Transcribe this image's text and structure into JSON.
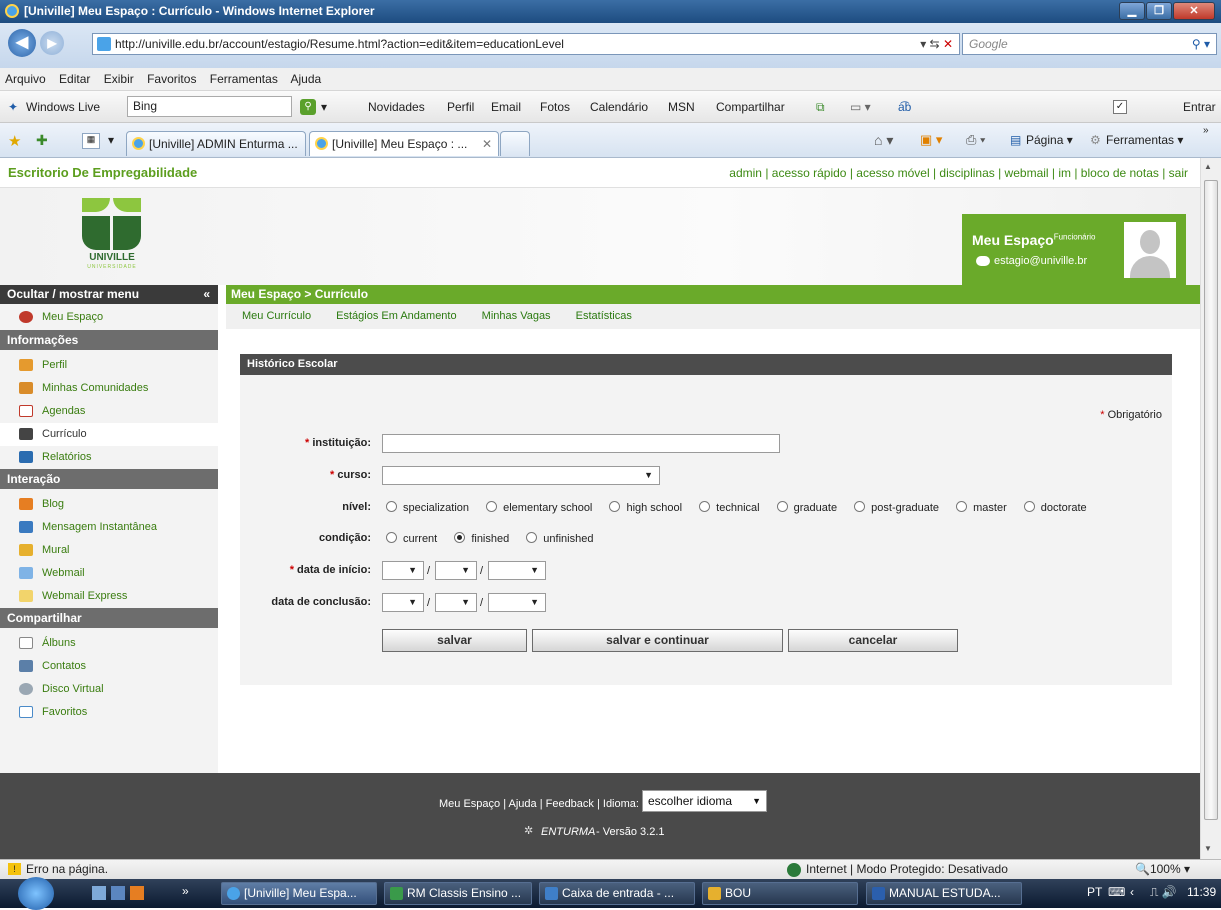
{
  "window": {
    "title": "[Univille] Meu Espaço : Currículo - Windows Internet Explorer"
  },
  "browser": {
    "url": "http://univille.edu.br/account/estagio/Resume.html?action=edit&item=educationLevel",
    "search_placeholder": "Google",
    "menu": [
      "Arquivo",
      "Editar",
      "Exibir",
      "Favoritos",
      "Ferramentas",
      "Ajuda"
    ],
    "live_bar": {
      "brand": "Windows Live",
      "search": "Bing",
      "links": [
        "Novidades",
        "Perfil",
        "Email",
        "Fotos",
        "Calendário",
        "MSN",
        "Compartilhar"
      ],
      "signin": "Entrar"
    },
    "tabs": [
      "[Univille] ADMIN Enturma ...",
      "[Univille] Meu Espaço : ..."
    ],
    "command_bar": {
      "page": "Página",
      "tools": "Ferramentas"
    },
    "status": {
      "left": "Erro na página.",
      "zone": "Internet | Modo Protegido: Desativado",
      "zoom": "100%"
    }
  },
  "site": {
    "name": "Escritorio De Empregabilidade",
    "top_links": "admin | acesso rápido | acesso móvel | disciplinas | webmail | im | bloco de notas | sair",
    "logo_text": "UNIVILLE",
    "logo_sub": "UNIVERSIDADE",
    "user_box": {
      "title": "Meu Espaço",
      "role": "Funcionário",
      "email": "estagio@univille.br"
    }
  },
  "sidebar": {
    "toggle": "Ocultar / mostrar menu",
    "home": "Meu Espaço",
    "sections": [
      {
        "title": "Informações",
        "items": [
          "Perfil",
          "Minhas Comunidades",
          "Agendas",
          "Currículo",
          "Relatórios"
        ]
      },
      {
        "title": "Interação",
        "items": [
          "Blog",
          "Mensagem Instantânea",
          "Mural",
          "Webmail",
          "Webmail Express"
        ]
      },
      {
        "title": "Compartilhar",
        "items": [
          "Álbuns",
          "Contatos",
          "Disco Virtual",
          "Favoritos"
        ]
      }
    ]
  },
  "main": {
    "breadcrumb": "Meu Espaço > Currículo",
    "subnav": [
      "Meu Currículo",
      "Estágios Em Andamento",
      "Minhas Vagas",
      "Estatísticas"
    ],
    "form_title": "Histórico Escolar",
    "required_note": "Obrigatório",
    "labels": {
      "institution": "instituição:",
      "course": "curso:",
      "level": "nível:",
      "condition": "condição:",
      "start": "data de início:",
      "end": "data de conclusão:"
    },
    "level_options": [
      "specialization",
      "elementary school",
      "high school",
      "technical",
      "graduate",
      "post-graduate",
      "master",
      "doctorate"
    ],
    "condition_options": [
      "current",
      "finished",
      "unfinished"
    ],
    "condition_selected": "finished",
    "date_sep": "/",
    "buttons": {
      "save": "salvar",
      "save_continue": "salvar e continuar",
      "cancel": "cancelar"
    }
  },
  "footer": {
    "links": "Meu Espaço | Ajuda | Feedback | Idioma:",
    "language_select": "escolher idioma",
    "brand": "ENTURMA",
    "version": "- Versão 3.2.1"
  },
  "taskbar": {
    "items": [
      "[Univille] Meu Espa...",
      "RM Classis Ensino ...",
      "Caixa de entrada - ...",
      "BOU",
      "MANUAL ESTUDA..."
    ],
    "lang": "PT",
    "clock": "11:39"
  }
}
